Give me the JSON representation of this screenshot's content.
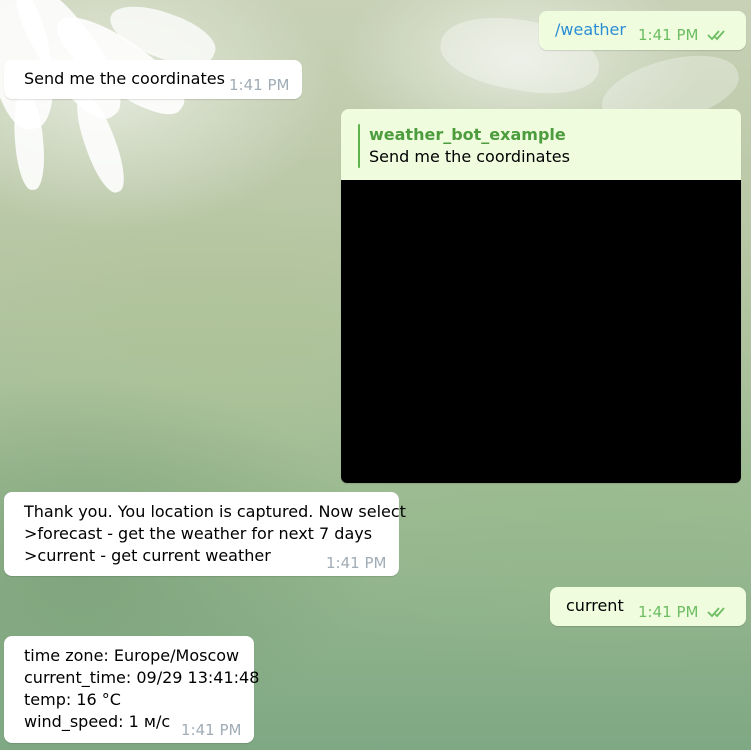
{
  "messages": [
    {
      "direction": "outgoing",
      "text": "/weather",
      "time": "1:41 PM",
      "status": "read"
    },
    {
      "direction": "incoming",
      "text": "Send me the coordinates",
      "time": "1:41 PM"
    },
    {
      "direction": "outgoing",
      "reply": {
        "author": "weather_bot_example",
        "text": "Send me the coordinates"
      },
      "attachment": "location-map"
    },
    {
      "direction": "incoming",
      "lines": [
        "Thank you. You location is captured. Now select",
        ">forecast - get the weather for next 7 days",
        ">current - get current weather"
      ],
      "time": "1:41 PM"
    },
    {
      "direction": "outgoing",
      "text": "current",
      "time": "1:41 PM",
      "status": "read"
    },
    {
      "direction": "incoming",
      "lines": [
        "time zone: Europe/Moscow",
        "current_time: 09/29 13:41:48",
        "temp: 16 °C",
        "wind_speed: 1 м/с"
      ],
      "time": "1:41 PM"
    }
  ],
  "colors": {
    "incoming_bubble": "#ffffff",
    "outgoing_bubble": "#effdde",
    "command_link": "#2b8dd4",
    "reply_author": "#4d9c3e",
    "read_check": "#6dbd63"
  },
  "icons": {
    "read_status": "double-check-icon"
  }
}
